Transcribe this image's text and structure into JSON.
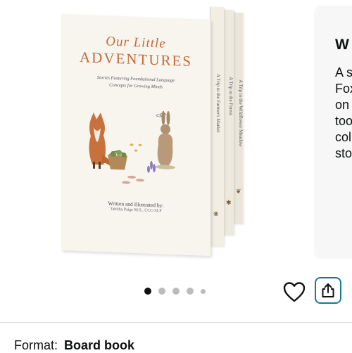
{
  "product": {
    "image_alt_name": "box-set-image",
    "cover": {
      "title_top": "Our Little",
      "title_main": "ADVENTURES",
      "subtitle_line1": "Stories Featuring Foundational Language",
      "subtitle_line2": "Concepts for Growing Minds",
      "credit": "Written and Illustrated by:",
      "author": "Tabitha Paige M.S., CCC-SLP"
    },
    "spines": [
      {
        "text": "A Trip to the Farmer's Market"
      },
      {
        "text": "A Trip to the Forest"
      },
      {
        "text": "A Trip to the Wildflower Meadow"
      }
    ]
  },
  "side_card": {
    "title": "W",
    "text": "A s\nFox\non\ntoo\ncol\nsto"
  },
  "carousel": {
    "total_dots": 5,
    "active_index": 0
  },
  "actions": {
    "favorite_icon": "heart-icon",
    "share_icon": "share-icon",
    "accent_color": "#1a7a8e"
  },
  "format": {
    "label": "Format:",
    "value": "Board book"
  }
}
